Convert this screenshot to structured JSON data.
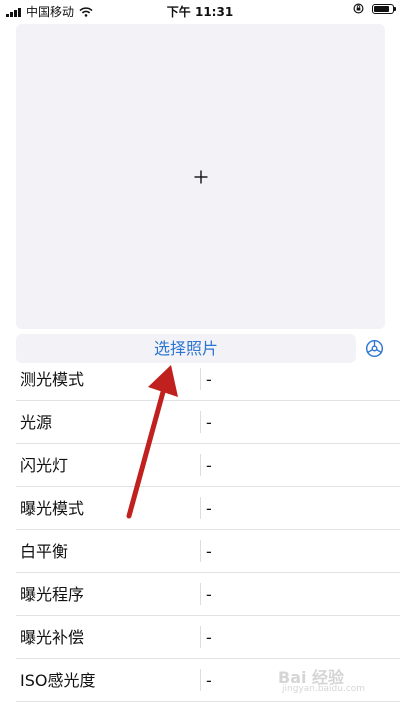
{
  "status_bar": {
    "carrier": "中国移动",
    "time": "下午 11:31",
    "battery_level": 0.85,
    "icons": [
      "signal-icon",
      "wifi-icon",
      "rotation-lock-icon",
      "battery-icon"
    ]
  },
  "photo_area": {
    "plus_symbol": "+"
  },
  "select_button": {
    "label": "选择照片"
  },
  "info_rows": [
    {
      "label": "测光模式",
      "value": "-"
    },
    {
      "label": "光源",
      "value": "-"
    },
    {
      "label": "闪光灯",
      "value": "-"
    },
    {
      "label": "曝光模式",
      "value": "-"
    },
    {
      "label": "白平衡",
      "value": "-"
    },
    {
      "label": "曝光程序",
      "value": "-"
    },
    {
      "label": "曝光补偿",
      "value": "-"
    },
    {
      "label": "ISO感光度",
      "value": "-"
    }
  ],
  "watermark": {
    "main": "Bai 经验",
    "sub": "jingyan.baidu.com"
  },
  "colors": {
    "accent": "#2c76d2",
    "panel": "#f2f2f7",
    "arrow": "#c0201e"
  }
}
